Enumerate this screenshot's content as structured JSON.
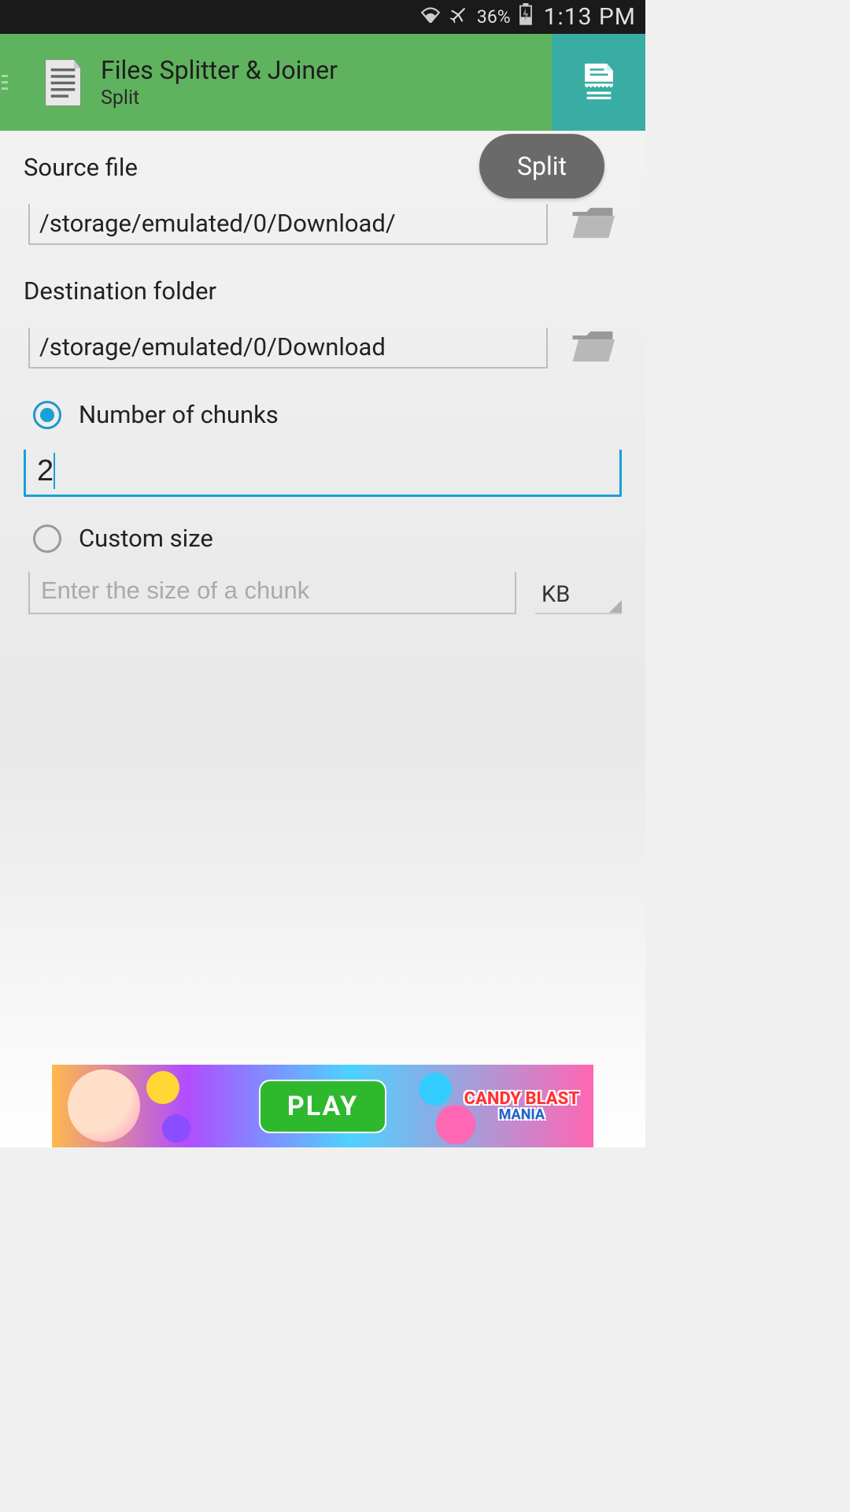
{
  "status": {
    "battery_pct": "36%",
    "time": "1:13 PM"
  },
  "appbar": {
    "title": "Files Splitter & Joiner",
    "subtitle": "Split"
  },
  "split_chip": "Split",
  "source": {
    "label": "Source file",
    "value": "/storage/emulated/0/Download/"
  },
  "destination": {
    "label": "Destination folder",
    "value": "/storage/emulated/0/Download"
  },
  "chunks": {
    "label": "Number of chunks",
    "value": "2",
    "selected": true
  },
  "custom": {
    "label": "Custom size",
    "placeholder": "Enter the size of a chunk",
    "selected": false
  },
  "unit": {
    "value": "KB"
  },
  "ad": {
    "play": "PLAY",
    "brand": "CANDY BLAST",
    "brand_sub": "MANIA"
  }
}
